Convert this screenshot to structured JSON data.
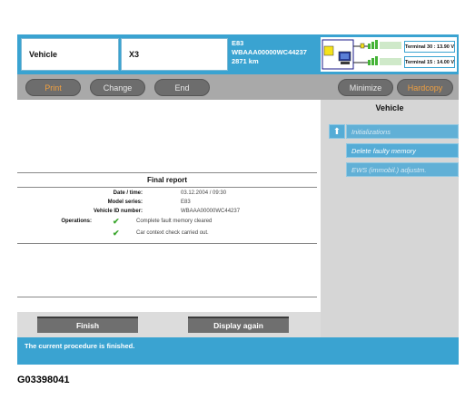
{
  "header": {
    "vehicle_label": "Vehicle",
    "model": "X3",
    "series": "E83",
    "vin": "WBAAA00000WC44237",
    "mileage": "2871 km",
    "terminal_30": "Terminal 30 : 13.90 V",
    "terminal_15": "Terminal 15 : 14.00 V"
  },
  "toolbar": {
    "print": "Print",
    "change": "Change",
    "end": "End",
    "minimize": "Minimize",
    "hardcopy": "Hardcopy"
  },
  "right_panel": {
    "title": "Vehicle",
    "functions": [
      "Initializations",
      "Delete faulty memory",
      "EWS (immobil.) adjustm."
    ]
  },
  "report": {
    "title": "Final report",
    "date_label": "Date / time:",
    "date_value": "03.12.2004 / 09:30",
    "series_label": "Model series:",
    "series_value": "E83",
    "vin_label": "Vehicle ID number:",
    "vin_value": "WBAAA00000WC44237",
    "ops_label": "Operations:",
    "ops": [
      "Complete fault memory cleared",
      "Car context check carried out."
    ]
  },
  "bottom": {
    "finish": "Finish",
    "display_again": "Display again",
    "status": "The current procedure is finished."
  },
  "caption": "G03398041",
  "colors": {
    "header_blue": "#3aa3d1",
    "toolbar_gray": "#a9a9a9",
    "accent_orange": "#f0a040",
    "check_green": "#3aa62d"
  }
}
